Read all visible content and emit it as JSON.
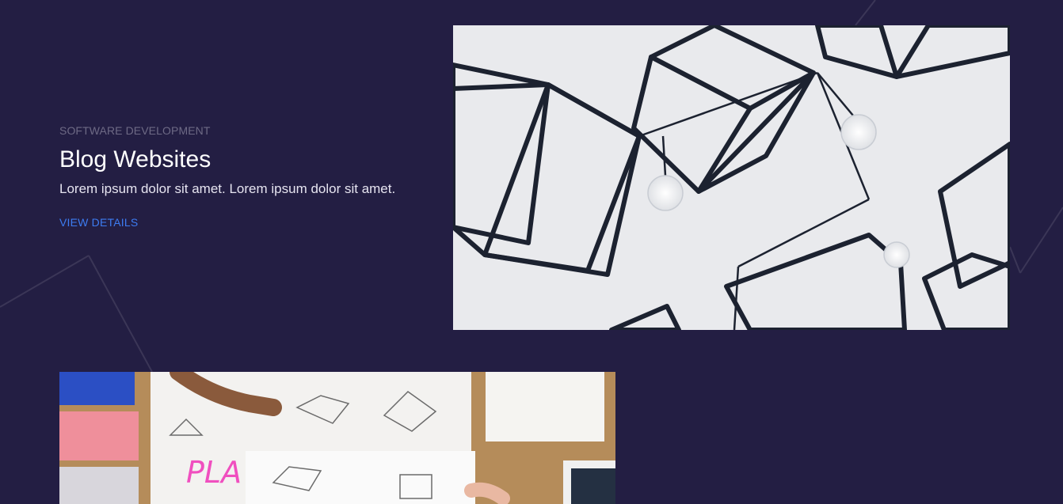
{
  "project": {
    "category": "SOFTWARE DEVELOPMENT",
    "title": "Blog Websites",
    "description": "Lorem ipsum dolor sit amet. Lorem ipsum dolor sit amet.",
    "link_label": "VIEW DETAILS"
  },
  "images": {
    "primary": "geometric-cube-pendant-lights-photo",
    "secondary": "sketching-on-paper-desk-photo"
  },
  "colors": {
    "background": "#231e43",
    "link": "#3d7cf2",
    "category": "#6e6a85",
    "title": "#ffffff"
  }
}
